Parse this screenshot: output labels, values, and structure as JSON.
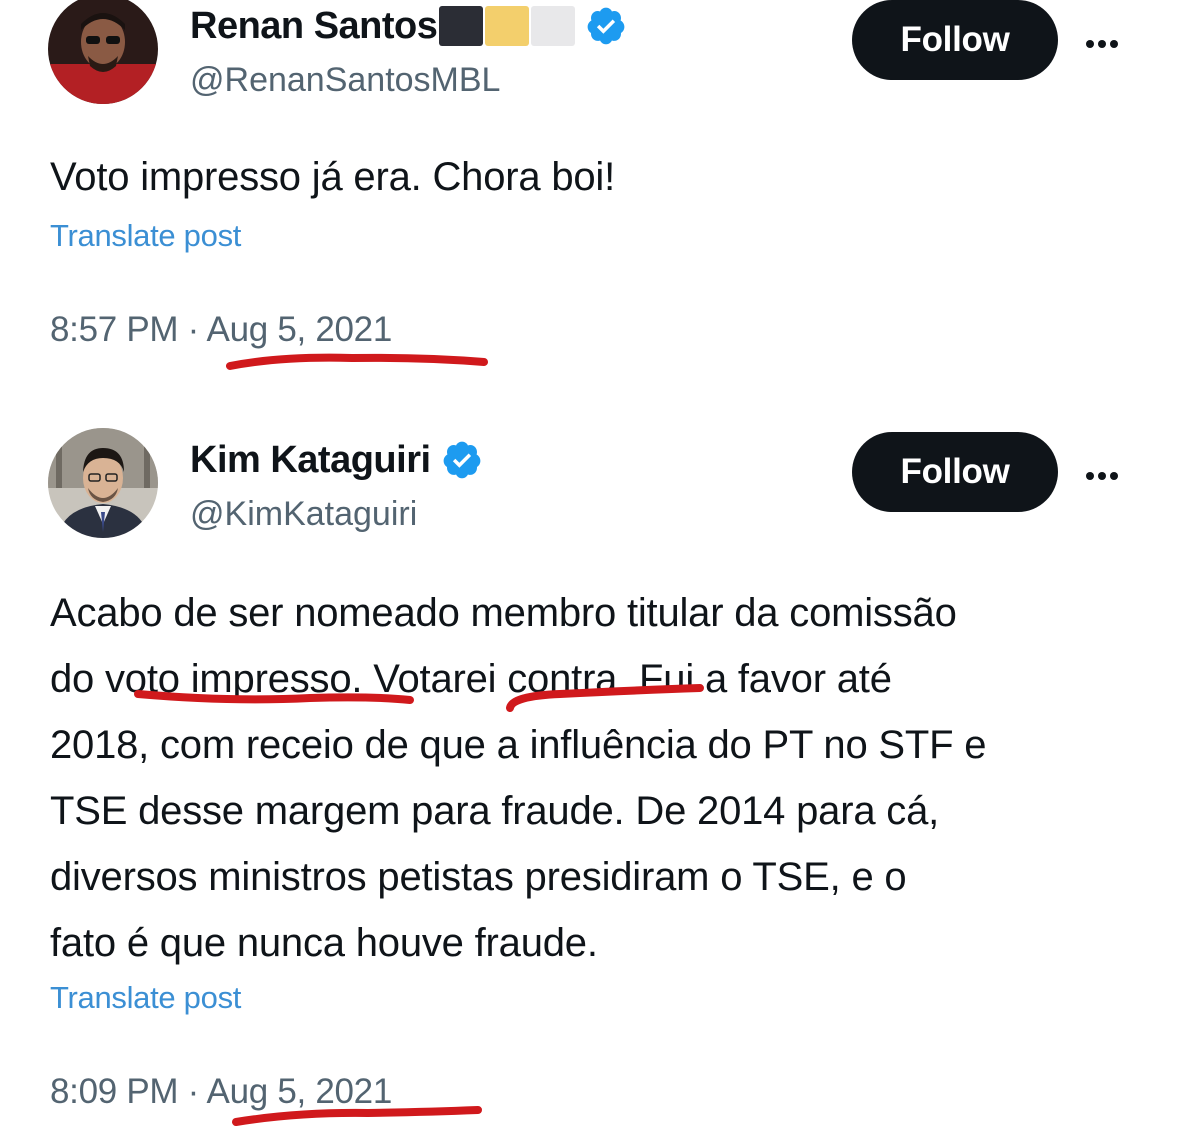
{
  "posts": [
    {
      "display_name": "Renan Santos",
      "handle": "@RenanSantosMBL",
      "follow_label": "Follow",
      "text": "Voto impresso já era. Chora boi!",
      "translate_label": "Translate post",
      "time": "8:57 PM",
      "separator": " · ",
      "date": "Aug 5, 2021",
      "name_flags": [
        "#2b2d35",
        "#f3cf6c",
        "#e8e8ea"
      ]
    },
    {
      "display_name": "Kim Kataguiri",
      "handle": "@KimKataguiri",
      "follow_label": "Follow",
      "text_lines": [
        "Acabo de ser nomeado membro titular da comissão",
        "do voto impresso. Votarei contra. Fui a favor até",
        "2018, com receio de que a influência do PT no STF e",
        "TSE desse margem para fraude. De 2014 para cá,",
        "diversos ministros petistas presidiram o TSE, e o",
        "fato é que nunca houve fraude."
      ],
      "translate_label": "Translate post",
      "time": "8:09 PM",
      "separator": " · ",
      "date": "Aug 5, 2021"
    }
  ],
  "colors": {
    "verified": "#1d9bf0",
    "underline": "#d0191c",
    "link": "#3b8fd4",
    "muted": "#536471",
    "follow_bg": "#0f1419"
  }
}
